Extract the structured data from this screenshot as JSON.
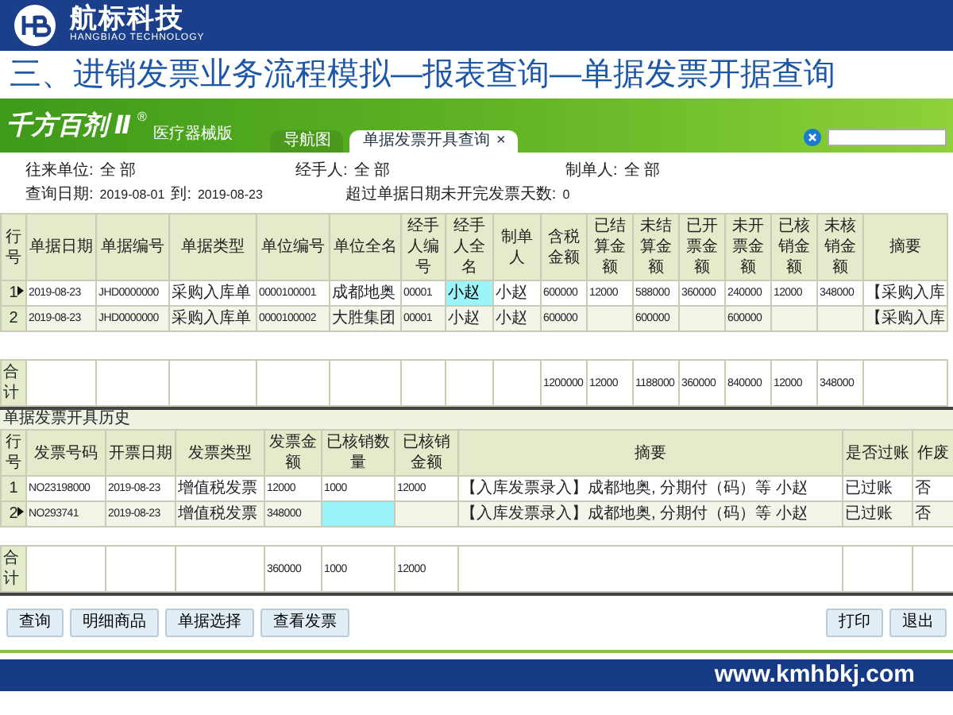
{
  "slide_header": {
    "brand": "航标科技",
    "brand_sub": "HANGBIAO TECHNOLOGY"
  },
  "slide_title": "三、进销发票业务流程模拟—报表查询—单据发票开据查询",
  "app": {
    "logo": {
      "name": "千方百剂",
      "mark": "Ⅱ",
      "reg": "®",
      "edition": "医疗器械版"
    },
    "tabs": [
      {
        "label": "导航图",
        "selected": false
      },
      {
        "label": "单据发票开具查询",
        "selected": true,
        "close": "×"
      }
    ],
    "filters": [
      {
        "label": "往来单位:",
        "value": "全 部"
      },
      {
        "label": "经手人:",
        "value": "全 部"
      },
      {
        "label": "制单人:",
        "value": "全 部"
      }
    ],
    "date_filter": {
      "label": "查询日期:",
      "from": "2019-08-01",
      "to_label": "到:",
      "to": "2019-08-23"
    },
    "overdue": {
      "label": "超过单据日期未开完发票天数:",
      "value": "0"
    },
    "bills": {
      "columns": [
        "行号",
        "单据日期",
        "单据编号",
        "单据类型",
        "单位编号",
        "单位全名",
        "经手人编号",
        "经手人全名",
        "制单人",
        "含税金额",
        "已结算金额",
        "未结算金额",
        "已开票金额",
        "未开票金额",
        "已核销金额",
        "未核销金额",
        "摘要"
      ],
      "rows": [
        {
          "current": true,
          "cells": [
            {
              "text": "1",
              "focused": false
            },
            {
              "text": "2019-08-23",
              "focused": false
            },
            {
              "text": "JHD0000000",
              "focused": false
            },
            {
              "text": "采购入库单",
              "focused": false
            },
            {
              "text": "0000100001",
              "focused": false
            },
            {
              "text": "成都地奥",
              "focused": false
            },
            {
              "text": "00001",
              "focused": false
            },
            {
              "text": "小赵",
              "focused": true
            },
            {
              "text": "小赵",
              "focused": false
            },
            {
              "text": "600000",
              "focused": false
            },
            {
              "text": "12000",
              "focused": false
            },
            {
              "text": "588000",
              "focused": false
            },
            {
              "text": "360000",
              "focused": false
            },
            {
              "text": "240000",
              "focused": false
            },
            {
              "text": "12000",
              "focused": false
            },
            {
              "text": "348000",
              "focused": false
            },
            {
              "text": "【采购入库",
              "focused": false
            }
          ]
        },
        {
          "current": false,
          "cells": [
            {
              "text": "2",
              "focused": false
            },
            {
              "text": "2019-08-23",
              "focused": false
            },
            {
              "text": "JHD0000000",
              "focused": false
            },
            {
              "text": "采购入库单",
              "focused": false
            },
            {
              "text": "0000100002",
              "focused": false
            },
            {
              "text": "大胜集团",
              "focused": false
            },
            {
              "text": "00001",
              "focused": false
            },
            {
              "text": "小赵",
              "focused": false
            },
            {
              "text": "小赵",
              "focused": false
            },
            {
              "text": "600000",
              "focused": false
            },
            {
              "focused": false
            },
            {
              "text": "600000",
              "focused": false
            },
            {
              "focused": false
            },
            {
              "text": "600000",
              "focused": false
            },
            {
              "focused": false
            },
            {
              "focused": false
            },
            {
              "text": "【采购入库",
              "focused": false
            }
          ]
        }
      ],
      "totals_label": "合计",
      "totals": [
        "1200000",
        "12000",
        "1188000",
        "360000",
        "840000",
        "12000",
        "348000"
      ]
    },
    "history_title": "单据发票开具历史",
    "invoices": {
      "columns": [
        "行号",
        "发票号码",
        "开票日期",
        "发票类型",
        "发票金额",
        "已核销数量",
        "已核销金额",
        "摘要",
        "是否过账",
        "作废"
      ],
      "rows": [
        {
          "current": false,
          "cells": [
            {
              "text": "1",
              "focused": false
            },
            {
              "text": "NO23198000",
              "focused": false
            },
            {
              "text": "2019-08-23",
              "focused": false
            },
            {
              "text": "增值税发票",
              "focused": false
            },
            {
              "text": "12000",
              "focused": false
            },
            {
              "text": "1000",
              "focused": false
            },
            {
              "text": "12000",
              "focused": false
            },
            {
              "text": "【入库发票录入】成都地奥, 分期付（码）等 小赵",
              "focused": false
            },
            {
              "text": "已过账",
              "focused": false
            },
            {
              "text": "否",
              "focused": false
            }
          ]
        },
        {
          "current": true,
          "cells": [
            {
              "text": "2",
              "focused": false
            },
            {
              "text": "NO293741",
              "focused": false
            },
            {
              "text": "2019-08-23",
              "focused": false
            },
            {
              "text": "增值税发票",
              "focused": false
            },
            {
              "text": "348000",
              "focused": false
            },
            {
              "focused": true
            },
            {
              "focused": false
            },
            {
              "text": "【入库发票录入】成都地奥, 分期付（码）等 小赵",
              "focused": false
            },
            {
              "text": "已过账",
              "focused": false
            },
            {
              "text": "否",
              "focused": false
            }
          ]
        }
      ],
      "totals_label": "合计",
      "totals": [
        "360000",
        "1000",
        "12000"
      ]
    },
    "buttons_left": [
      "查询",
      "明细商品",
      "单据选择",
      "查看发票"
    ],
    "buttons_right": [
      "打印",
      "退出"
    ]
  },
  "footer": {
    "url": "www.kmhbkj.com"
  }
}
